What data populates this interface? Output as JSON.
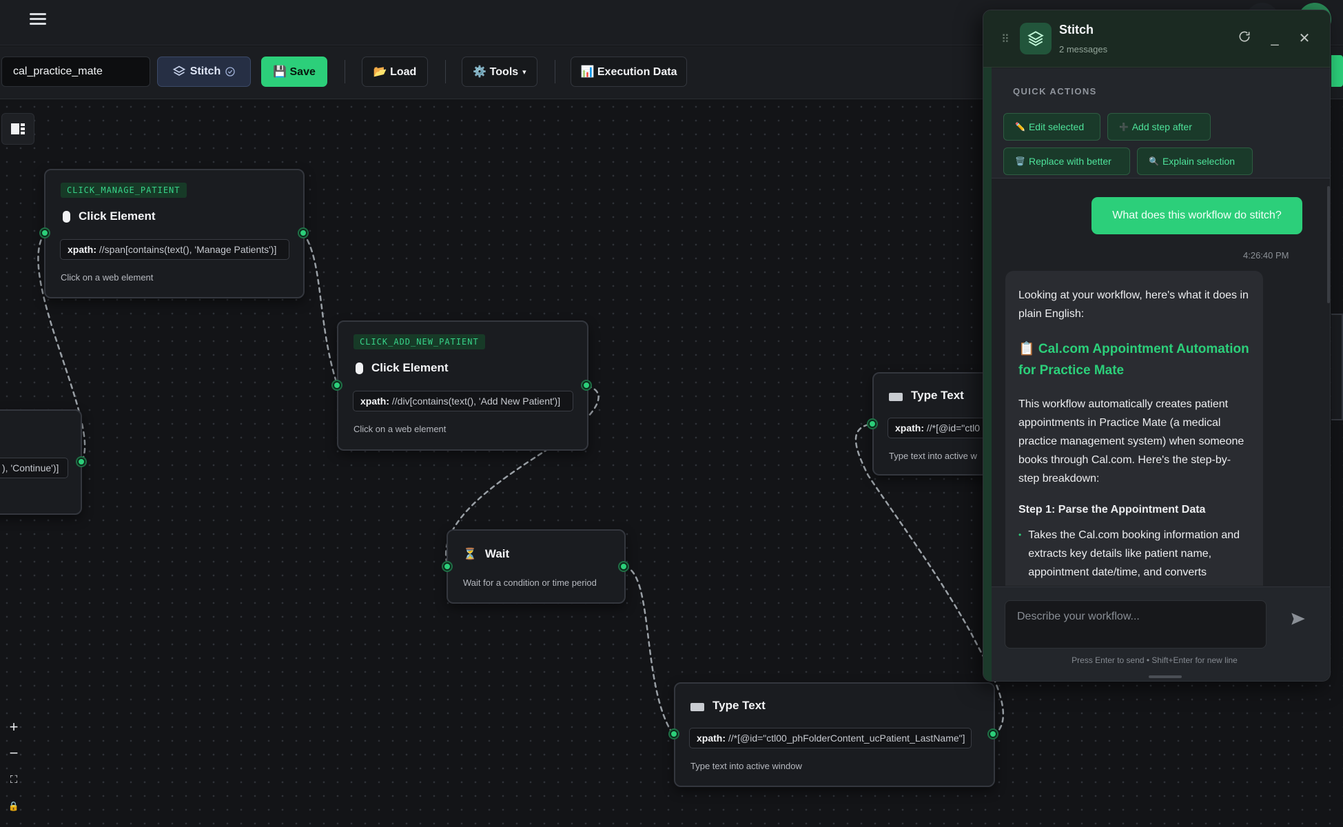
{
  "toolbar": {
    "workflow_name": "cal_practice_mate",
    "stitch_label": "Stitch",
    "save_label": "💾 Save",
    "load_label": "📂 Load",
    "tools_label": "⚙️ Tools",
    "tools_caret": "▾",
    "execution_label": "📊 Execution Data"
  },
  "nodes": {
    "manage_patient": {
      "tag": "CLICK_MANAGE_PATIENT",
      "title": "Click Element",
      "xpath_key": "xpath:",
      "xpath": "//span[contains(text(), 'Manage Patients')]",
      "desc": "Click on a web element"
    },
    "add_new_patient": {
      "tag": "CLICK_ADD_NEW_PATIENT",
      "title": "Click Element",
      "xpath_key": "xpath:",
      "xpath": "//div[contains(text(), 'Add New Patient')]",
      "desc": "Click on a web element"
    },
    "continue_partial": {
      "xpath": "), 'Continue')]"
    },
    "wait": {
      "icon": "⏳",
      "title": "Wait",
      "desc": "Wait for a condition or time period"
    },
    "type_text_top": {
      "title": "Type Text",
      "xpath_key": "xpath:",
      "xpath": "//*[@id=\"ctl0",
      "desc": "Type text into active w"
    },
    "type_text_bottom": {
      "title": "Type Text",
      "xpath_key": "xpath:",
      "xpath": "//*[@id=\"ctl00_phFolderContent_ucPatient_LastName\"]",
      "desc": "Type text into active window"
    }
  },
  "zoom": {
    "plus": "+",
    "minus": "−",
    "fit": "⛶",
    "lock": "🔒"
  },
  "stitch": {
    "title": "Stitch",
    "subtitle": "2 messages",
    "quick_actions_label": "QUICK ACTIONS",
    "actions": [
      {
        "icon": "✏️",
        "label": "Edit selected"
      },
      {
        "icon": "➕",
        "label": "Add step after"
      },
      {
        "icon": "🗑️",
        "label": "Replace with better"
      },
      {
        "icon": "🔍",
        "label": "Explain selection"
      }
    ],
    "user_message": "What does this workflow do stitch?",
    "user_time": "4:26:40 PM",
    "bot_intro": "Looking at your workflow, here's what it does in plain English:",
    "bot_heading": "📋 Cal.com Appointment Automation for Practice Mate",
    "bot_paragraph": "This workflow automatically creates patient appointments in Practice Mate (a medical practice management system) when someone books through Cal.com. Here's the step-by-step breakdown:",
    "bot_step": "Step 1: Parse the Appointment Data",
    "bot_bullet": "Takes the Cal.com booking information and extracts key details like patient name, appointment date/time, and converts",
    "input_placeholder": "Describe your workflow...",
    "hint": "Press Enter to send • Shift+Enter for new line"
  },
  "colors": {
    "accent": "#2ccf7a",
    "background": "#141518",
    "node_border": "#34373e"
  }
}
